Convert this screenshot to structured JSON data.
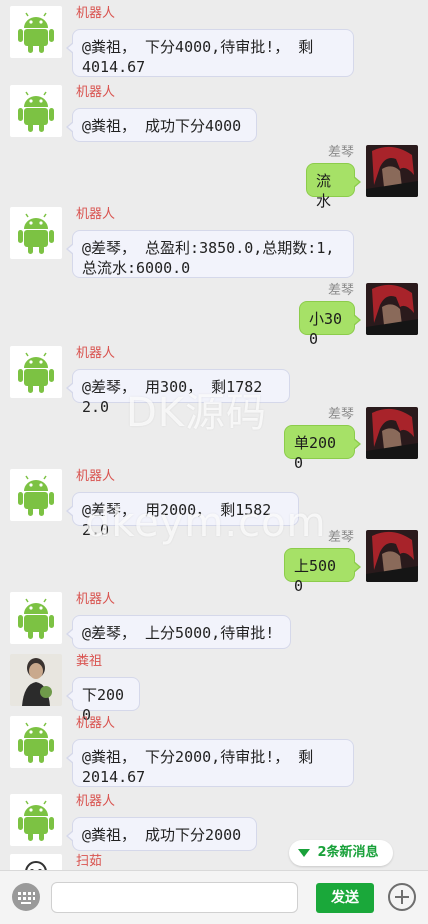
{
  "messages": [
    {
      "side": "left",
      "avatar": "android-robot-avatar",
      "name": "机器人",
      "text": "@粪祖， 下分4000,待审批!， 剩\n4014.67"
    },
    {
      "side": "left",
      "avatar": "android-robot-avatar",
      "name": "机器人",
      "text": "@粪祖， 成功下分4000"
    },
    {
      "side": "right",
      "avatar": "red-hair-character-avatar",
      "name": "差琴",
      "text": "流水"
    },
    {
      "side": "left",
      "avatar": "android-robot-avatar",
      "name": "机器人",
      "text": "@差琴， 总盈利:3850.0,总期数:1,\n总流水:6000.0"
    },
    {
      "side": "right",
      "avatar": "red-hair-character-avatar",
      "name": "差琴",
      "text": "小300"
    },
    {
      "side": "left",
      "avatar": "android-robot-avatar",
      "name": "机器人",
      "text": "@差琴， 用300， 剩17822.0"
    },
    {
      "side": "right",
      "avatar": "red-hair-character-avatar",
      "name": "差琴",
      "text": "单2000"
    },
    {
      "side": "left",
      "avatar": "android-robot-avatar",
      "name": "机器人",
      "text": "@差琴， 用2000， 剩15822.0"
    },
    {
      "side": "right",
      "avatar": "red-hair-character-avatar",
      "name": "差琴",
      "text": "上5000"
    },
    {
      "side": "left",
      "avatar": "android-robot-avatar",
      "name": "机器人",
      "text": "@差琴， 上分5000,待审批!"
    },
    {
      "side": "left",
      "avatar": "man-photo-avatar",
      "name": "粪祖",
      "text": "下2000"
    },
    {
      "side": "left",
      "avatar": "android-robot-avatar",
      "name": "机器人",
      "text": "@粪祖， 下分2000,待审批!， 剩\n2014.67"
    },
    {
      "side": "left",
      "avatar": "android-robot-avatar",
      "name": "机器人",
      "text": "@粪祖， 成功下分2000"
    },
    {
      "side": "left",
      "avatar": "cartoon-avatar",
      "name": "扫茹",
      "text": ""
    }
  ],
  "watermark": {
    "line1": "DK源码",
    "line2": "dkeym.com"
  },
  "new_messages_badge": "2条新消息",
  "input": {
    "placeholder": "",
    "send_label": "发送"
  },
  "colors": {
    "robot_name": "#d9534f",
    "self_bubble": "#a6e167",
    "send_button": "#1aa83a",
    "badge_text": "#19a13a"
  }
}
